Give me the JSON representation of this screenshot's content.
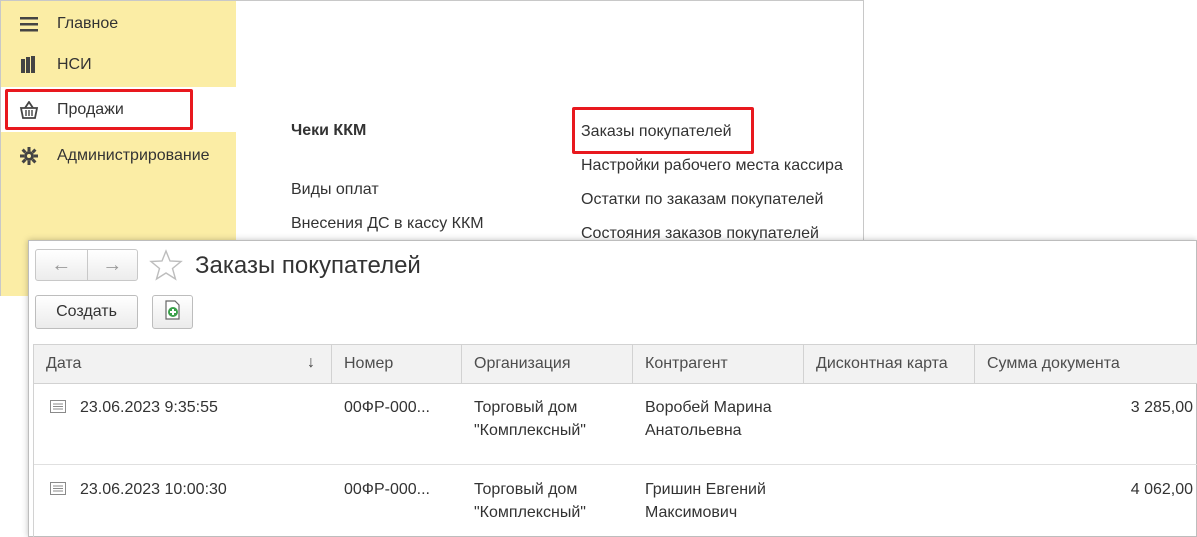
{
  "sidebar": {
    "items": [
      {
        "label": "Главное",
        "icon": "menu-icon"
      },
      {
        "label": "НСИ",
        "icon": "books-icon"
      },
      {
        "label": "Продажи",
        "icon": "basket-icon"
      },
      {
        "label": "Администрирование",
        "icon": "gear-icon"
      }
    ]
  },
  "section": {
    "title": "Чеки ККМ",
    "left_links": [
      "Виды оплат",
      "Внесения ДС в кассу ККМ"
    ],
    "right_links": [
      "Заказы покупателей",
      "Настройки рабочего места кассира",
      "Остатки по заказам покупателей",
      "Состояния заказов покупателей"
    ]
  },
  "form": {
    "title": "Заказы покупателей",
    "nav_back": "←",
    "nav_forward": "→",
    "create_label": "Создать"
  },
  "table": {
    "columns": [
      "Дата",
      "Номер",
      "Организация",
      "Контрагент",
      "Дисконтная карта",
      "Сумма документа"
    ],
    "sort_indicator": "↓",
    "rows": [
      {
        "date": "23.06.2023 9:35:55",
        "number": "00ФР-000...",
        "org_line1": "Торговый дом",
        "org_line2": "\"Комплексный\"",
        "contractor_line1": "Воробей Марина",
        "contractor_line2": "Анатольевна",
        "card": "",
        "sum": "3 285,00"
      },
      {
        "date": "23.06.2023 10:00:30",
        "number": "00ФР-000...",
        "org_line1": "Торговый дом",
        "org_line2": "\"Комплексный\"",
        "contractor_line1": "Гришин Евгений",
        "contractor_line2": "Максимович",
        "card": "",
        "sum": "4 062,00"
      }
    ]
  },
  "colors": {
    "sidebar_bg": "#fbeda5",
    "highlight": "#e8181e",
    "header_bg": "#f2f2f2"
  }
}
